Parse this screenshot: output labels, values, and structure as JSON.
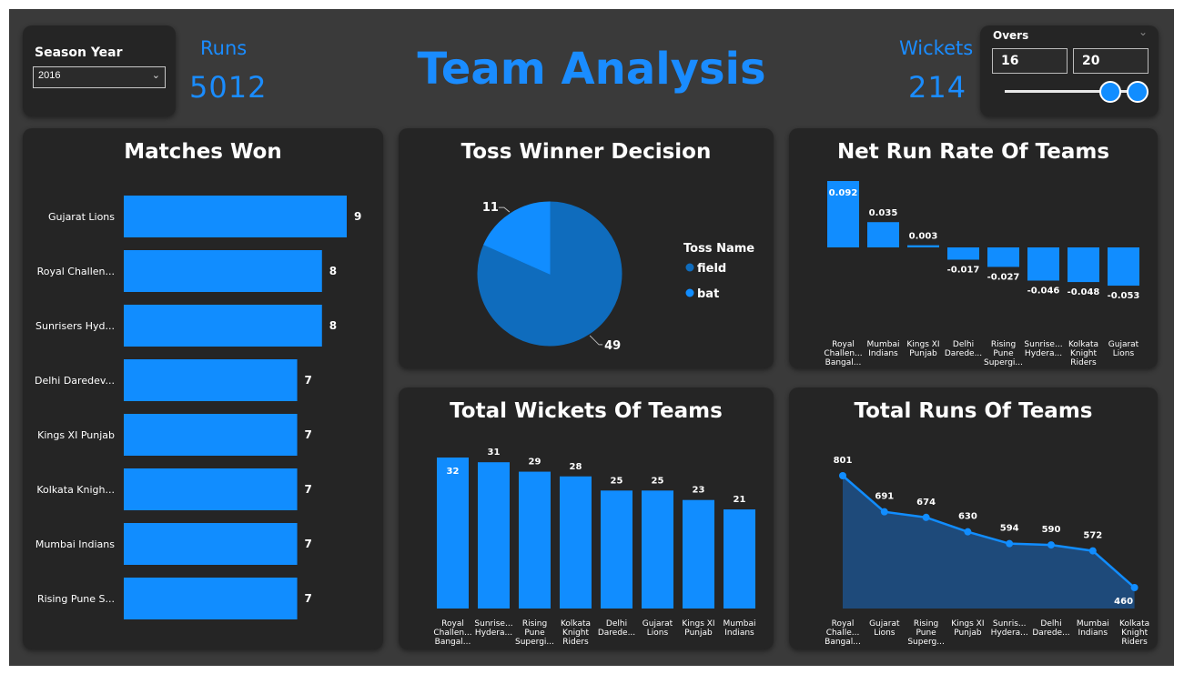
{
  "header": {
    "title": "Team Analysis",
    "season_label": "Season Year",
    "season_value": "2016",
    "runs_label": "Runs",
    "runs_value": "5012",
    "wickets_label": "Wickets",
    "wickets_value": "214",
    "overs_label": "Overs",
    "overs_min": "16",
    "overs_max": "20"
  },
  "colors": {
    "accent": "#118dff",
    "pie_dark": "#0f6cbd",
    "background": "#3a3a3a",
    "card": "#252525"
  },
  "charts": {
    "matches_won": {
      "title": "Matches Won",
      "chart_data": {
        "type": "bar",
        "orientation": "horizontal",
        "categories": [
          "Gujarat Lions",
          "Royal Challen...",
          "Sunrisers Hyd...",
          "Delhi Daredev...",
          "Kings XI Punjab",
          "Kolkata Knigh...",
          "Mumbai Indians",
          "Rising Pune S..."
        ],
        "values": [
          9,
          8,
          8,
          7,
          7,
          7,
          7,
          7
        ],
        "xlim": [
          0,
          9
        ]
      }
    },
    "toss_decision": {
      "title": "Toss Winner Decision",
      "legend_title": "Toss Name",
      "chart_data": {
        "type": "pie",
        "labels": [
          "field",
          "bat"
        ],
        "values": [
          49,
          11
        ],
        "legend": "right"
      }
    },
    "net_run_rate": {
      "title": "Net Run Rate Of Teams",
      "chart_data": {
        "type": "bar",
        "categories": [
          [
            "Royal",
            "Challen...",
            "Bangal..."
          ],
          [
            "Mumbai",
            "Indians"
          ],
          [
            "Kings XI",
            "Punjab"
          ],
          [
            "Delhi",
            "Darede..."
          ],
          [
            "Rising",
            "Pune",
            "Supergi..."
          ],
          [
            "Sunrise...",
            "Hydera..."
          ],
          [
            "Kolkata",
            "Knight",
            "Riders"
          ],
          [
            "Gujarat",
            "Lions"
          ]
        ],
        "values": [
          0.092,
          0.035,
          0.003,
          -0.017,
          -0.027,
          -0.046,
          -0.048,
          -0.053
        ],
        "labels": [
          "0.092",
          "0.035",
          "0.003",
          "-0.017",
          "-0.027",
          "-0.046",
          "-0.048",
          "-0.053"
        ]
      }
    },
    "total_wickets": {
      "title": "Total Wickets Of Teams",
      "chart_data": {
        "type": "bar",
        "categories": [
          [
            "Royal",
            "Challen...",
            "Bangal..."
          ],
          [
            "Sunrise...",
            "Hydera..."
          ],
          [
            "Rising",
            "Pune",
            "Supergi..."
          ],
          [
            "Kolkata",
            "Knight",
            "Riders"
          ],
          [
            "Delhi",
            "Darede..."
          ],
          [
            "Gujarat",
            "Lions"
          ],
          [
            "Kings XI",
            "Punjab"
          ],
          [
            "Mumbai",
            "Indians"
          ]
        ],
        "values": [
          32,
          31,
          29,
          28,
          25,
          25,
          23,
          21
        ],
        "ylim": [
          0,
          32
        ]
      }
    },
    "total_runs": {
      "title": "Total Runs Of Teams",
      "chart_data": {
        "type": "area",
        "categories": [
          [
            "Royal",
            "Challe...",
            "Bangal..."
          ],
          [
            "Gujarat",
            "Lions"
          ],
          [
            "Rising",
            "Pune",
            "Superg..."
          ],
          [
            "Kings XI",
            "Punjab"
          ],
          [
            "Sunris...",
            "Hydera..."
          ],
          [
            "Delhi",
            "Darede..."
          ],
          [
            "Mumbai",
            "Indians"
          ],
          [
            "Kolkata",
            "Knight",
            "Riders"
          ]
        ],
        "values": [
          801,
          691,
          674,
          630,
          594,
          590,
          572,
          460
        ],
        "ylim": [
          0,
          801
        ]
      }
    }
  }
}
